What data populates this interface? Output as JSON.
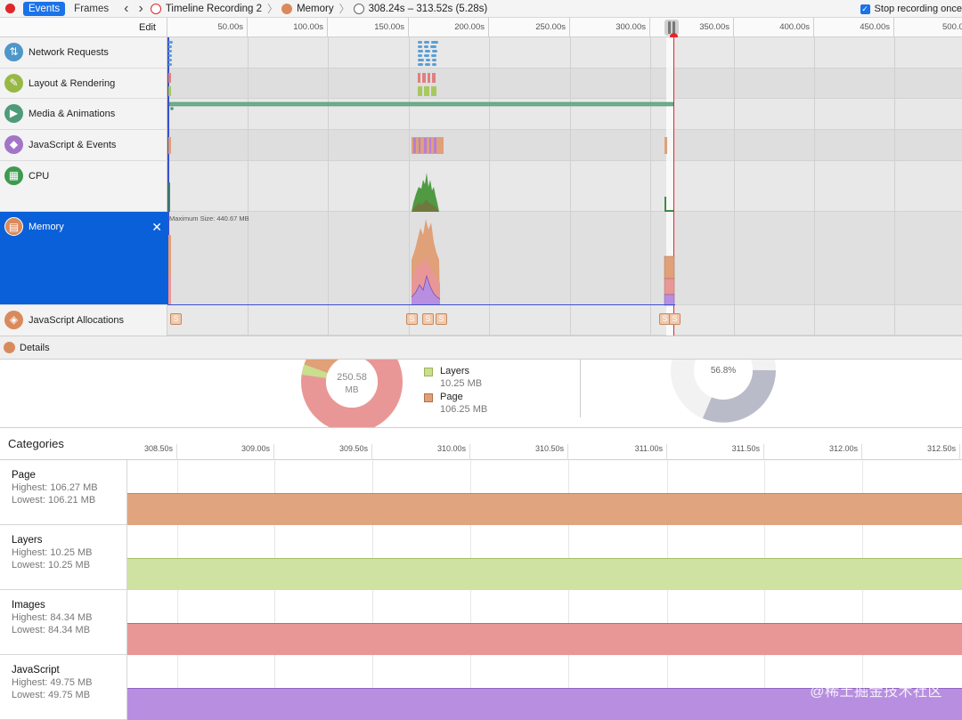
{
  "toolbar": {
    "tab_events": "Events",
    "tab_frames": "Frames",
    "back_arrow": "‹",
    "forward_arrow": "›",
    "breadcrumb_recording": "Timeline Recording 2",
    "breadcrumb_memory": "Memory",
    "breadcrumb_range": "308.24s – 313.52s (5.28s)",
    "stop_recording_label": "Stop recording once",
    "stop_recording_checked": true
  },
  "timeline": {
    "edit_label": "Edit",
    "ticks": [
      "50.00s",
      "100.00s",
      "150.00s",
      "200.00s",
      "250.00s",
      "300.00s",
      "350.00s",
      "400.00s",
      "450.00s",
      "500.0"
    ],
    "max_size_label": "Maximum Size: 440.67 MB",
    "tracks": [
      {
        "label": "Network Requests",
        "icon": "network-icon",
        "color": "#4e97c9"
      },
      {
        "label": "Layout & Rendering",
        "icon": "paintbrush-icon",
        "color": "#98b846"
      },
      {
        "label": "Media & Animations",
        "icon": "camera-icon",
        "color": "#4f9b79"
      },
      {
        "label": "JavaScript & Events",
        "icon": "script-icon",
        "color": "#a275c9"
      },
      {
        "label": "CPU",
        "icon": "cpu-icon",
        "color": "#3e9a4f"
      },
      {
        "label": "Memory",
        "icon": "memory-icon",
        "color": "#d98a5c"
      },
      {
        "label": "JavaScript Allocations",
        "icon": "cube-icon",
        "color": "#d98a5c"
      }
    ],
    "allocation_marker": "S"
  },
  "details": {
    "label": "Details"
  },
  "overview": {
    "donut_center_value": "250.58",
    "donut_center_unit": "MB",
    "legend": [
      {
        "name": "Layers",
        "value": "10.25 MB",
        "color": "#c9de8f"
      },
      {
        "name": "Page",
        "value": "106.25 MB",
        "color": "#e0a078"
      }
    ],
    "pressure_percent": "56.8%"
  },
  "categories": {
    "title": "Categories",
    "ticks": [
      "308.50s",
      "309.00s",
      "309.50s",
      "310.00s",
      "310.50s",
      "311.00s",
      "311.50s",
      "312.00s",
      "312.50s"
    ],
    "rows": [
      {
        "name": "Page",
        "highest": "Highest: 106.27 MB",
        "lowest": "Lowest: 106.21 MB",
        "color": "#e0a57f"
      },
      {
        "name": "Layers",
        "highest": "Highest: 10.25 MB",
        "lowest": "Lowest: 10.25 MB",
        "color": "#d0e2a2"
      },
      {
        "name": "Images",
        "highest": "Highest: 84.34 MB",
        "lowest": "Lowest: 84.34 MB",
        "color": "#e99796"
      },
      {
        "name": "JavaScript",
        "highest": "Highest: 49.75 MB",
        "lowest": "Lowest: 49.75 MB",
        "color": "#b88fe0"
      }
    ]
  },
  "watermark": "@稀土掘金技术社区"
}
